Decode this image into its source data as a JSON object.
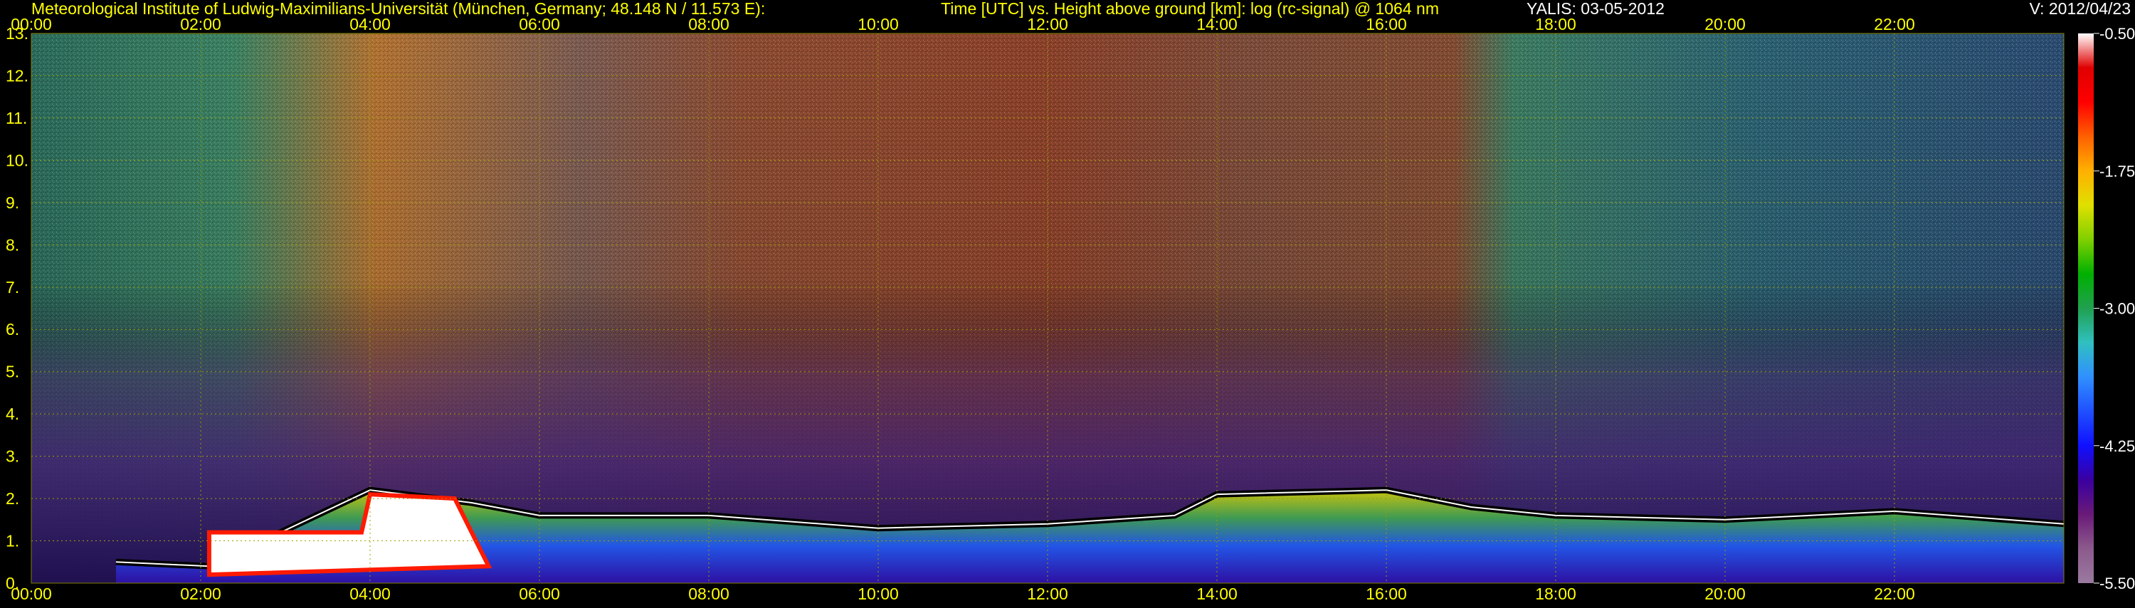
{
  "header": {
    "institute": "Meteorological Institute of Ludwig-Maximilians-Universität (München, Germany; 48.148 N / 11.573 E):",
    "title": "Time [UTC] vs. Height above ground [km]: log (rc-signal) @ 1064 nm",
    "station_date": "YALIS: 03-05-2012",
    "version": "V: 2012/04/23"
  },
  "chart_data": {
    "type": "heatmap",
    "title": "Time [UTC] vs. Height above ground [km]: log (rc-signal) @ 1064 nm",
    "xlabel": "Time [UTC]",
    "ylabel": "Height above ground [km]",
    "x_ticks": [
      "00:00",
      "02:00",
      "04:00",
      "06:00",
      "08:00",
      "10:00",
      "12:00",
      "14:00",
      "16:00",
      "18:00",
      "20:00",
      "22:00"
    ],
    "x_tick_hours": [
      0,
      2,
      4,
      6,
      8,
      10,
      12,
      14,
      16,
      18,
      20,
      22
    ],
    "xlim": [
      0,
      24
    ],
    "y_ticks": [
      "0.",
      "1.",
      "2.",
      "3.",
      "4.",
      "5.",
      "6.",
      "7.",
      "8.",
      "9.",
      "10.",
      "11.",
      "12.",
      "13."
    ],
    "ylim": [
      0,
      13
    ],
    "grid": true,
    "colorbar": {
      "tick_labels": [
        "-0.50",
        "-1.75",
        "-3.00",
        "-4.25",
        "-5.50"
      ],
      "range": [
        -5.5,
        -0.5
      ],
      "colors": [
        "#9a7aa0",
        "#8c5a8c",
        "#6a1a78",
        "#3a00a0",
        "#1010ff",
        "#2050ff",
        "#3090ff",
        "#30c0c0",
        "#20a050",
        "#00b000",
        "#80d000",
        "#e0e000",
        "#ffb000",
        "#ff6000",
        "#ff0000",
        "#e00000",
        "#ffffff"
      ]
    },
    "layers": [
      {
        "name": "boundary-layer top",
        "unit": "km",
        "points": [
          [
            1.0,
            0.5
          ],
          [
            2.1,
            0.4
          ],
          [
            4.0,
            2.2
          ],
          [
            5.2,
            1.9
          ],
          [
            6.0,
            1.6
          ],
          [
            8.0,
            1.6
          ],
          [
            10.0,
            1.3
          ],
          [
            12.0,
            1.4
          ],
          [
            13.5,
            1.6
          ],
          [
            14.0,
            2.1
          ],
          [
            16.0,
            2.2
          ],
          [
            17.0,
            1.8
          ],
          [
            18.0,
            1.6
          ],
          [
            20.0,
            1.5
          ],
          [
            22.0,
            1.7
          ],
          [
            24.0,
            1.4
          ]
        ]
      }
    ]
  }
}
